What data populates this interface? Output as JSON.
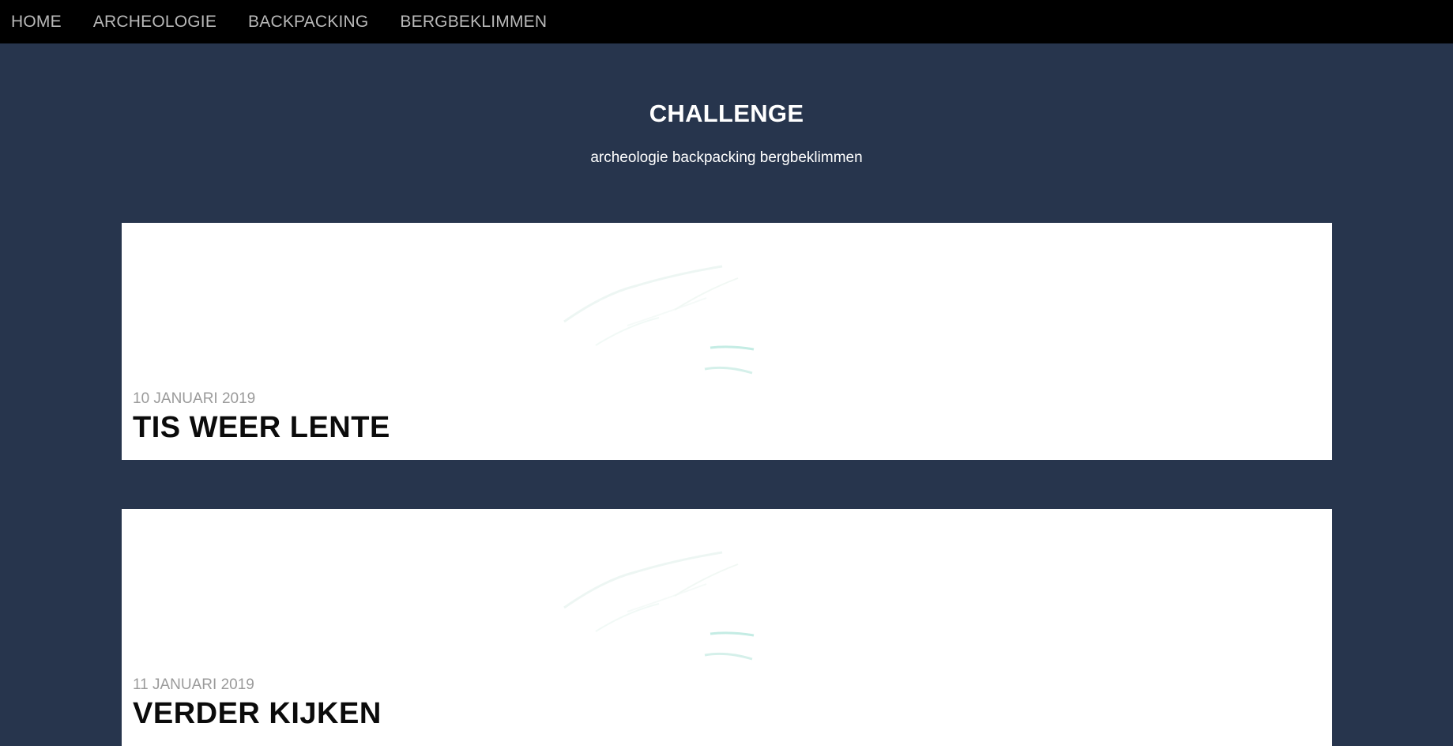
{
  "nav": {
    "items": [
      {
        "label": "HOME"
      },
      {
        "label": "ARCHEOLOGIE"
      },
      {
        "label": "BACKPACKING"
      },
      {
        "label": "BERGBEKLIMMEN"
      }
    ]
  },
  "header": {
    "title": "CHALLENGE",
    "tagline": "archeologie backpacking bergbeklimmen"
  },
  "posts": [
    {
      "date": "10 JANUARI 2019",
      "title": "TIS WEER LENTE"
    },
    {
      "date": "11 JANUARI 2019",
      "title": "VERDER KIJKEN"
    }
  ],
  "colors": {
    "background": "#27354d",
    "nav_background": "#000000",
    "nav_text": "#b9b9b9",
    "card_background": "#ffffff",
    "date_text": "#9a9a9a"
  }
}
